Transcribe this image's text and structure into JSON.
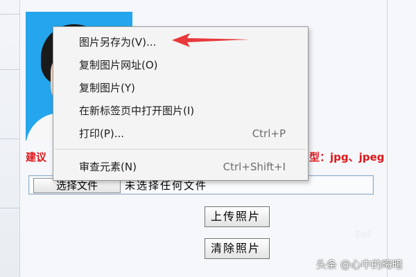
{
  "photo": {
    "background_color": "#25a6ec"
  },
  "hint": {
    "left_text": "建议",
    "right_text": "型：jpg、jpeg",
    "color": "#e0161b"
  },
  "file_input": {
    "button_label": "选择文件",
    "status_text": "未选择任何文件"
  },
  "actions": {
    "upload_label": "上传照片",
    "clear_label": "清除照片"
  },
  "partial_text": "t+I",
  "context_menu": {
    "items": [
      {
        "label": "图片另存为(V)...",
        "shortcut": ""
      },
      {
        "label": "复制图片网址(O)",
        "shortcut": ""
      },
      {
        "label": "复制图片(Y)",
        "shortcut": ""
      },
      {
        "label": "在新标签页中打开图片(I)",
        "shortcut": ""
      },
      {
        "label": "打印(P)...",
        "shortcut": "Ctrl+P"
      },
      {
        "label": "审查元素(N)",
        "shortcut": "Ctrl+Shift+I"
      }
    ]
  },
  "annotation": {
    "arrow_color": "#e8393b",
    "arrow_icon": "left-arrow-icon"
  },
  "watermark": {
    "text": "头条 @心中的晦暗"
  }
}
